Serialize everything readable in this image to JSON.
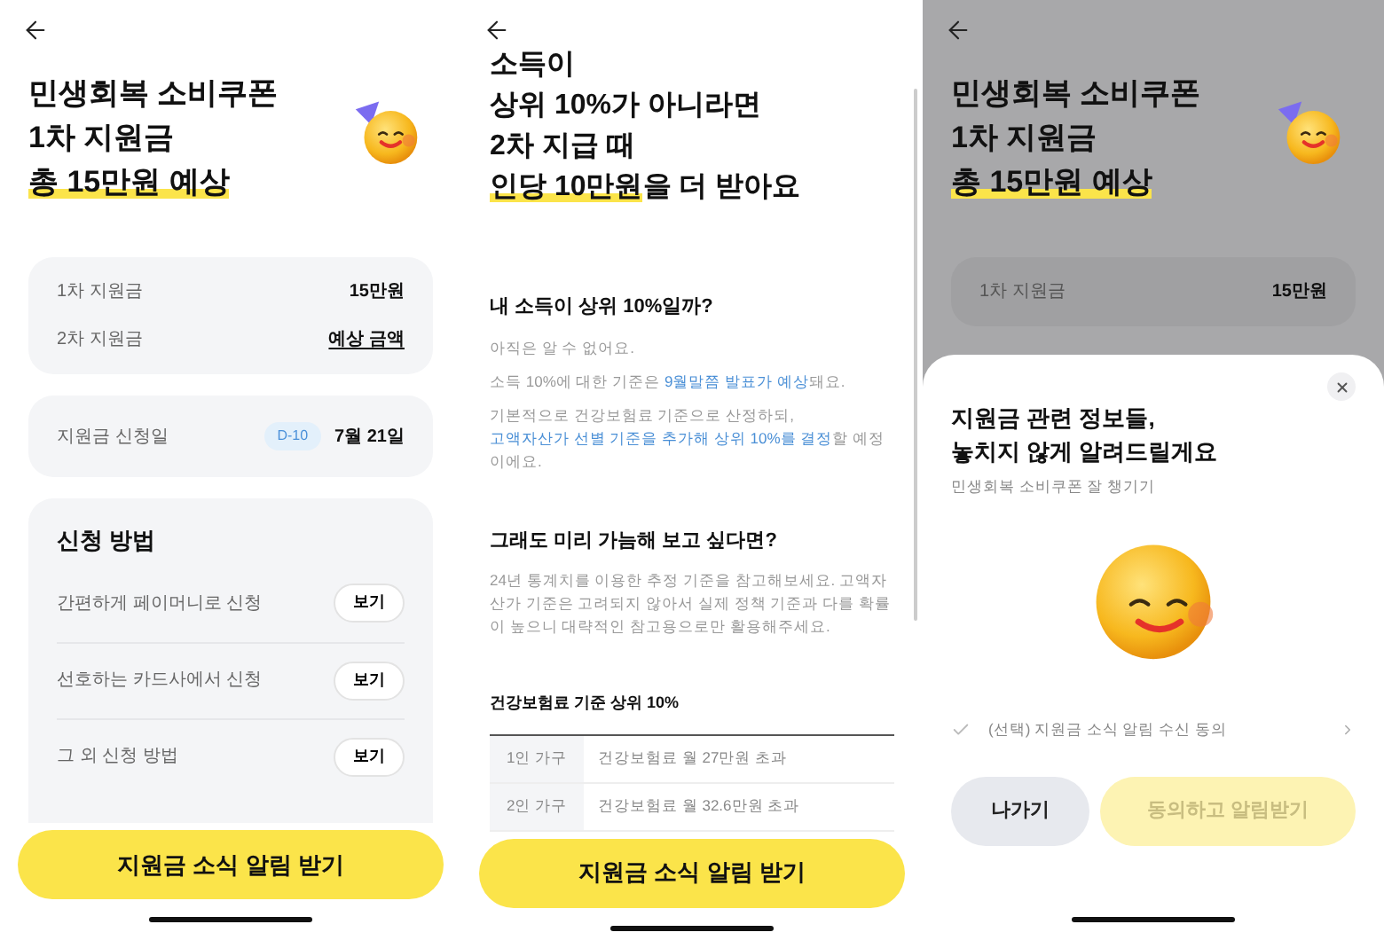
{
  "screens": [
    {
      "kind": "summary",
      "title_lines": [
        [
          {
            "text": "민생회복 소비쿠폰",
            "highlight": false
          }
        ],
        [
          {
            "text": "1차 지원금",
            "highlight": false
          }
        ],
        [
          {
            "text": "총 15만원 예상",
            "highlight": true
          }
        ]
      ],
      "amounts": [
        {
          "label": "1차 지원금",
          "value": "15만원",
          "underlined": false
        },
        {
          "label": "2차 지원금",
          "value": "예상 금액",
          "underlined": true
        }
      ],
      "apply_date": {
        "label": "지원금 신청일",
        "badge": "D-10",
        "date": "7월 21일"
      },
      "methods": {
        "title": "신청 방법",
        "items": [
          {
            "label": "간편하게 페이머니로 신청",
            "button": "보기"
          },
          {
            "label": "선호하는 카드사에서 신청",
            "button": "보기"
          },
          {
            "label": "그 외 신청 방법",
            "button": "보기"
          }
        ]
      },
      "cta": "지원금 소식 알림 받기"
    },
    {
      "kind": "info",
      "title_lines": [
        [
          {
            "text": "소득이",
            "highlight": false
          }
        ],
        [
          {
            "text": "상위 10%가 아니라면",
            "highlight": false
          }
        ],
        [
          {
            "text": "2차 지급 때",
            "highlight": false
          }
        ],
        [
          {
            "text": "인당 10만원",
            "highlight": true
          },
          {
            "text": "을 더 받아요",
            "highlight": false
          }
        ]
      ],
      "sections": [
        {
          "heading": "내 소득이 상위 10%일까?",
          "paragraphs": [
            [
              {
                "text": "아직은 알 수 없어요.",
                "link": false
              }
            ],
            [
              {
                "text": "소득 10%에 대한 기준은 ",
                "link": false
              },
              {
                "text": "9월말쯤 발표가 예상",
                "link": true
              },
              {
                "text": "돼요.",
                "link": false
              }
            ],
            [
              {
                "text": "기본적으로 건강보험료 기준으로 산정하되, ",
                "link": false
              },
              {
                "text": "고액자산가 선별 기준을 추가해 상위 10%를 결정",
                "link": true
              },
              {
                "text": "할 예정이에요.",
                "link": false
              }
            ]
          ]
        },
        {
          "heading": "그래도 미리 가늠해 보고 싶다면?",
          "paragraphs": [
            [
              {
                "text": "24년 통계치를 이용한 추정 기준을 참고해보세요. 고액자산가 기준은 고려되지 않아서 실제 정책 기준과 다를 확률이 높으니 대략적인 참고용으로만 활용해주세요.",
                "link": false
              }
            ]
          ]
        }
      ],
      "table": {
        "title": "건강보험료 기준 상위 10%",
        "rows": [
          {
            "household": "1인 가구",
            "criterion": "건강보험료 월 27만원 초과"
          },
          {
            "household": "2인 가구",
            "criterion": "건강보험료 월 32.6만원 초과"
          }
        ]
      },
      "cta": "지원금 소식 알림 받기"
    },
    {
      "kind": "sheet",
      "title_lines": [
        [
          {
            "text": "민생회복 소비쿠폰",
            "highlight": false
          }
        ],
        [
          {
            "text": "1차 지원금",
            "highlight": false
          }
        ],
        [
          {
            "text": "총 15만원 예상",
            "highlight": true
          }
        ]
      ],
      "amounts": [
        {
          "label": "1차 지원금",
          "value": "15만원",
          "underlined": false
        }
      ],
      "sheet": {
        "title": "지원금 관련 정보들,\n놓치지 않게 알려드릴게요",
        "subtitle": "민생회복 소비쿠폰 잘 챙기기",
        "consent": {
          "label": "(선택) 지원금 소식 알림 수신 동의",
          "checked": false
        },
        "buttons": [
          {
            "label": "나가기",
            "kind": "secondary",
            "disabled": false
          },
          {
            "label": "동의하고 알림받기",
            "kind": "primary",
            "disabled": true
          }
        ]
      }
    }
  ]
}
